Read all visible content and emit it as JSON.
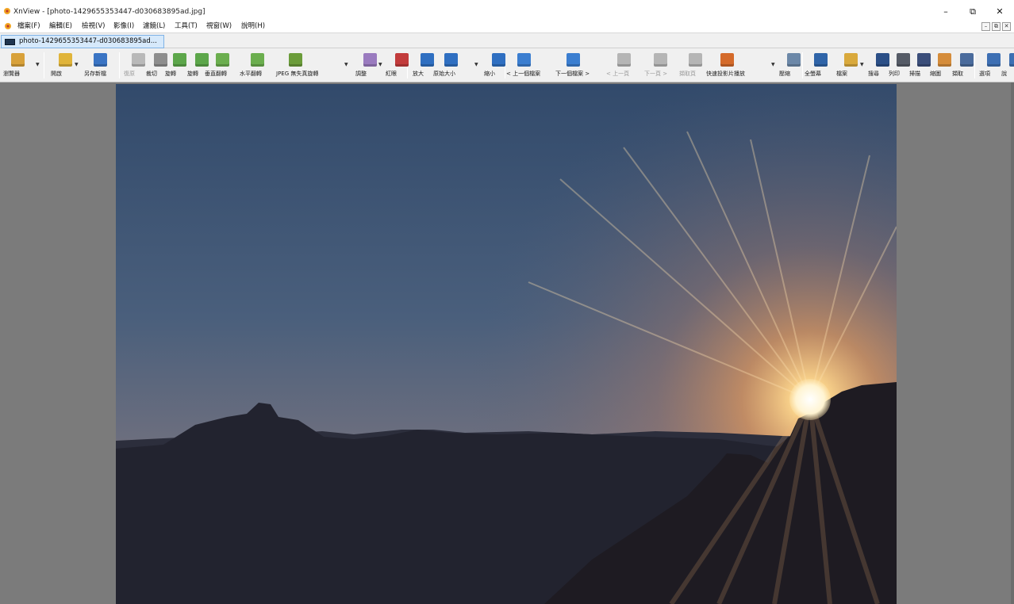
{
  "window": {
    "title": "XnView - [photo-1429655353447-d030683895ad.jpg]",
    "minimize_icon": "minimize-icon",
    "maximize_icon": "restore-icon",
    "close_icon": "close-icon"
  },
  "menu": {
    "items": [
      "檔案(F)",
      "編輯(E)",
      "檢視(V)",
      "影像(I)",
      "濾鏡(L)",
      "工具(T)",
      "視窗(W)",
      "說明(H)"
    ]
  },
  "tab": {
    "label": "photo-1429655353447-d030683895ad..."
  },
  "toolbar": {
    "buttons": [
      {
        "label": "瀏覽器",
        "icon": "browser-icon",
        "color": "#d8a13a",
        "enabled": true
      },
      {
        "label": "開啟",
        "icon": "open-folder-icon",
        "color": "#e0b43a",
        "enabled": true
      },
      {
        "label": "另存新檔",
        "icon": "save-as-icon",
        "color": "#3a74c4",
        "enabled": true
      },
      {
        "label": "復原",
        "icon": "undo-icon",
        "color": "#b9b9b9",
        "enabled": false
      },
      {
        "label": "裁切",
        "icon": "crop-icon",
        "color": "#8d8d8d",
        "enabled": true
      },
      {
        "label": "旋轉",
        "icon": "rotate-left-icon",
        "color": "#5ca64a",
        "enabled": true
      },
      {
        "label": "旋轉",
        "icon": "rotate-right-icon",
        "color": "#5ca64a",
        "enabled": true
      },
      {
        "label": "垂直翻轉",
        "icon": "flip-vertical-icon",
        "color": "#6bae4e",
        "enabled": true
      },
      {
        "label": "水平翻轉",
        "icon": "flip-horizontal-icon",
        "color": "#6bae4e",
        "enabled": true
      },
      {
        "label": "JPEG 無失真旋轉",
        "icon": "jpeg-lossless-icon",
        "color": "#6b9c3a",
        "enabled": true
      },
      {
        "label": "調整",
        "icon": "adjust-icon",
        "color": "#9a7bbf",
        "enabled": true
      },
      {
        "label": "紅眼",
        "icon": "red-eye-icon",
        "color": "#c23b3b",
        "enabled": true
      },
      {
        "label": "放大",
        "icon": "zoom-in-icon",
        "color": "#2f6fc1",
        "enabled": true
      },
      {
        "label": "原始大小",
        "icon": "actual-size-icon",
        "color": "#2f6fc1",
        "enabled": true
      },
      {
        "label": "縮小",
        "icon": "zoom-out-icon",
        "color": "#2f6fc1",
        "enabled": true
      },
      {
        "label": "< 上一個檔案",
        "icon": "previous-file-icon",
        "color": "#3b7ed0",
        "enabled": true
      },
      {
        "label": "下一個檔案 >",
        "icon": "next-file-icon",
        "color": "#3b7ed0",
        "enabled": true
      },
      {
        "label": "< 上一頁",
        "icon": "previous-page-icon",
        "color": "#b5b5b5",
        "enabled": false
      },
      {
        "label": "下一頁 >",
        "icon": "next-page-icon",
        "color": "#b5b5b5",
        "enabled": false
      },
      {
        "label": "擷取頁",
        "icon": "extract-page-icon",
        "color": "#b5b5b5",
        "enabled": false
      },
      {
        "label": "快速投影片播放",
        "icon": "slideshow-icon",
        "color": "#d46a2a",
        "enabled": true
      },
      {
        "label": "壓縮",
        "icon": "compress-icon",
        "color": "#6c88a8",
        "enabled": true
      },
      {
        "label": "全螢幕",
        "icon": "fullscreen-icon",
        "color": "#2f64a8",
        "enabled": true
      },
      {
        "label": "檔案",
        "icon": "file-icon",
        "color": "#d9a93c",
        "enabled": true
      },
      {
        "label": "搜尋",
        "icon": "search-icon",
        "color": "#2b4f87",
        "enabled": true
      },
      {
        "label": "列印",
        "icon": "print-icon",
        "color": "#555b66",
        "enabled": true
      },
      {
        "label": "掃描",
        "icon": "scan-icon",
        "color": "#3b4e7a",
        "enabled": true
      },
      {
        "label": "縮圖",
        "icon": "thumbnails-icon",
        "color": "#d58c3a",
        "enabled": true
      },
      {
        "label": "擷取",
        "icon": "capture-icon",
        "color": "#4a6b9c",
        "enabled": true
      },
      {
        "label": "選項",
        "icon": "options-gear-icon",
        "color": "#3d6fb3",
        "enabled": true
      },
      {
        "label": "說",
        "icon": "help-icon",
        "color": "#3d6fb3",
        "enabled": true
      }
    ]
  },
  "colors": {
    "viewer_background": "#7b7b7b",
    "tab_active": "#d6e9fb",
    "sky_top": "#324a6b",
    "sun_glow": "#ffe9b8"
  }
}
